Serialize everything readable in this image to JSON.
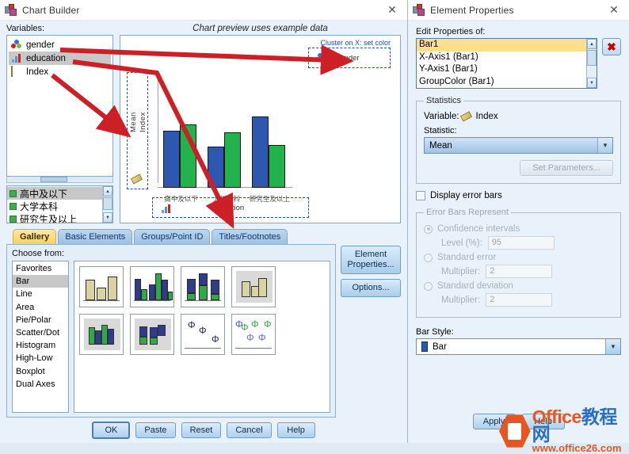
{
  "chart_builder": {
    "title": "Chart Builder",
    "title_icon": "chart-builder-icon",
    "close_label": "✕",
    "variables_label": "Variables:",
    "variables": [
      {
        "name": "gender",
        "icon": "nominal-variable-icon",
        "selected": false
      },
      {
        "name": "education",
        "icon": "ordinal-variable-icon",
        "selected": true
      },
      {
        "name": "Index",
        "icon": "scale-variable-icon",
        "selected": false
      }
    ],
    "categories": [
      {
        "label": "高中及以下",
        "selected": true
      },
      {
        "label": "大学本科",
        "selected": false
      },
      {
        "label": "研究生及以上",
        "selected": false
      }
    ],
    "preview_title": "Chart preview uses example data",
    "dropzones": {
      "cluster_label": "Cluster on X: set color",
      "cluster_value": "gender",
      "y_value_line1": "Mean",
      "y_value_line2": "Index",
      "x_value": "education"
    },
    "tabs": [
      {
        "label": "Gallery",
        "active": true
      },
      {
        "label": "Basic Elements",
        "active": false
      },
      {
        "label": "Groups/Point ID",
        "active": false
      },
      {
        "label": "Titles/Footnotes",
        "active": false
      }
    ],
    "choose_from_label": "Choose from:",
    "gallery_types": [
      {
        "label": "Favorites",
        "selected": false
      },
      {
        "label": "Bar",
        "selected": true
      },
      {
        "label": "Line",
        "selected": false
      },
      {
        "label": "Area",
        "selected": false
      },
      {
        "label": "Pie/Polar",
        "selected": false
      },
      {
        "label": "Scatter/Dot",
        "selected": false
      },
      {
        "label": "Histogram",
        "selected": false
      },
      {
        "label": "High-Low",
        "selected": false
      },
      {
        "label": "Boxplot",
        "selected": false
      },
      {
        "label": "Dual Axes",
        "selected": false
      }
    ],
    "gallery_thumbnails": [
      "simple-bar-thumbnail",
      "clustered-bar-thumbnail",
      "stacked-bar-thumbnail",
      "3d-bar-thumbnail",
      "3d-clustered-bar-thumbnail",
      "3d-stacked-bar-thumbnail",
      "simple-error-bar-thumbnail",
      "clustered-error-bar-thumbnail"
    ],
    "side_buttons": [
      {
        "label": "Element Properties...",
        "name": "element-properties-button"
      },
      {
        "label": "Options...",
        "name": "options-button"
      }
    ],
    "footer_buttons": [
      {
        "label": "OK",
        "default": true
      },
      {
        "label": "Paste",
        "default": false
      },
      {
        "label": "Reset",
        "default": false
      },
      {
        "label": "Cancel",
        "default": false
      },
      {
        "label": "Help",
        "default": false
      }
    ]
  },
  "element_properties": {
    "title": "Element Properties",
    "title_icon": "element-properties-icon",
    "close_label": "✕",
    "edit_properties_label": "Edit Properties of:",
    "property_items": [
      {
        "label": "Bar1",
        "selected": true
      },
      {
        "label": "X-Axis1 (Bar1)",
        "selected": false
      },
      {
        "label": "Y-Axis1 (Bar1)",
        "selected": false
      },
      {
        "label": "GroupColor (Bar1)",
        "selected": false
      }
    ],
    "delete_button_label": "✖",
    "statistics": {
      "legend": "Statistics",
      "variable_label": "Variable:",
      "variable_value": "Index",
      "statistic_label": "Statistic:",
      "statistic_value": "Mean",
      "set_parameters_label": "Set Parameters..."
    },
    "display_error_bars_label": "Display error bars",
    "error_bars": {
      "legend": "Error Bars Represent",
      "options": [
        {
          "label": "Confidence intervals",
          "selected": true,
          "sub_label": "Level (%):",
          "sub_value": "95"
        },
        {
          "label": "Standard error",
          "selected": false,
          "sub_label": "Multiplier:",
          "sub_value": "2"
        },
        {
          "label": "Standard deviation",
          "selected": false,
          "sub_label": "Multiplier:",
          "sub_value": "2"
        }
      ]
    },
    "bar_style_label": "Bar Style:",
    "bar_style_value": "Bar",
    "footer_buttons": [
      {
        "label": "Apply"
      },
      {
        "label": "Help"
      }
    ]
  },
  "watermark": {
    "line1_a": "Office",
    "line1_b": "教程网",
    "line2": "www.office26.com"
  },
  "chart_data": {
    "type": "bar",
    "title": "Chart preview uses example data",
    "xlabel": "education",
    "ylabel": "Mean Index",
    "categories": [
      "高中及以下",
      "大学本科",
      "研究生及以上"
    ],
    "series": [
      {
        "name": "gender-blue",
        "color": "#2e57b0",
        "values": [
          72,
          52,
          90
        ]
      },
      {
        "name": "gender-green",
        "color": "#22b34b",
        "values": [
          80,
          70,
          54
        ]
      }
    ],
    "ylim": [
      0,
      100
    ],
    "grid": false,
    "legend": "none"
  },
  "colors": {
    "accent_blue": "#2e57b0",
    "accent_green": "#22b34b",
    "selected_yellow": "#ffe08a",
    "arrow_red": "#cc2026",
    "tab_active": "#f5d25f"
  }
}
